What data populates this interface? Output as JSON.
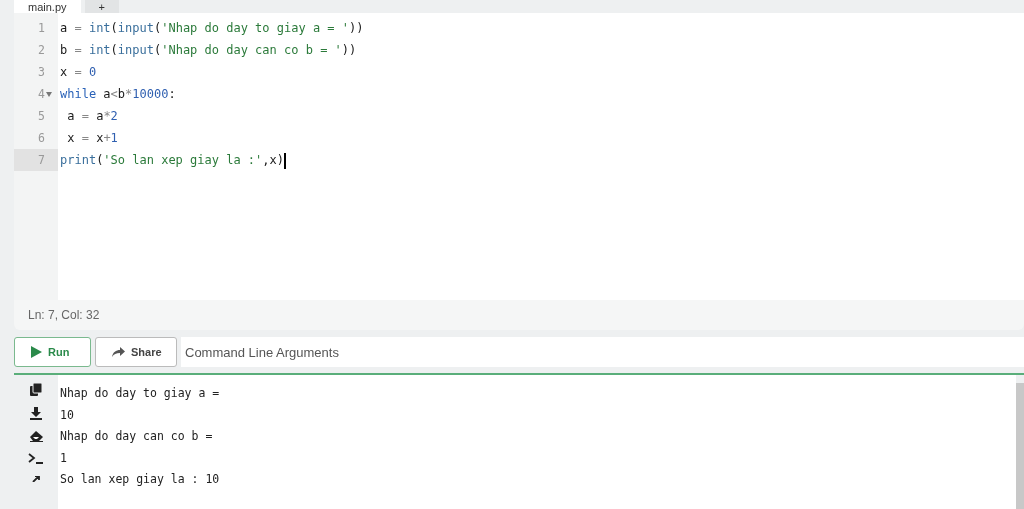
{
  "tabs": [
    {
      "label": "main.py",
      "selected": true
    },
    {
      "label": "+",
      "selected": false
    }
  ],
  "editor": {
    "lines": [
      {
        "number": "1",
        "foldable": false,
        "active": false,
        "tokens": [
          {
            "kind": "plain",
            "text": "a"
          },
          {
            "kind": "op",
            "text": " = "
          },
          {
            "kind": "builtin",
            "text": "int"
          },
          {
            "kind": "plain",
            "text": "("
          },
          {
            "kind": "builtin",
            "text": "input"
          },
          {
            "kind": "plain",
            "text": "("
          },
          {
            "kind": "string",
            "text": "'Nhap do day to giay a = '"
          },
          {
            "kind": "plain",
            "text": "))"
          }
        ]
      },
      {
        "number": "2",
        "foldable": false,
        "active": false,
        "tokens": [
          {
            "kind": "plain",
            "text": "b"
          },
          {
            "kind": "op",
            "text": " = "
          },
          {
            "kind": "builtin",
            "text": "int"
          },
          {
            "kind": "plain",
            "text": "("
          },
          {
            "kind": "builtin",
            "text": "input"
          },
          {
            "kind": "plain",
            "text": "("
          },
          {
            "kind": "string",
            "text": "'Nhap do day can co b = '"
          },
          {
            "kind": "plain",
            "text": "))"
          }
        ]
      },
      {
        "number": "3",
        "foldable": false,
        "active": false,
        "tokens": [
          {
            "kind": "plain",
            "text": "x"
          },
          {
            "kind": "op",
            "text": " = "
          },
          {
            "kind": "number",
            "text": "0"
          }
        ]
      },
      {
        "number": "4",
        "foldable": true,
        "active": false,
        "tokens": [
          {
            "kind": "keyword",
            "text": "while"
          },
          {
            "kind": "plain",
            "text": " a"
          },
          {
            "kind": "op",
            "text": "<"
          },
          {
            "kind": "plain",
            "text": "b"
          },
          {
            "kind": "op",
            "text": "*"
          },
          {
            "kind": "number",
            "text": "10000"
          },
          {
            "kind": "plain",
            "text": ":"
          }
        ]
      },
      {
        "number": "5",
        "foldable": false,
        "active": false,
        "tokens": [
          {
            "kind": "plain",
            "text": " a "
          },
          {
            "kind": "op",
            "text": "="
          },
          {
            "kind": "plain",
            "text": " a"
          },
          {
            "kind": "op",
            "text": "*"
          },
          {
            "kind": "number",
            "text": "2"
          }
        ]
      },
      {
        "number": "6",
        "foldable": false,
        "active": false,
        "tokens": [
          {
            "kind": "plain",
            "text": " x "
          },
          {
            "kind": "op",
            "text": "="
          },
          {
            "kind": "plain",
            "text": " x"
          },
          {
            "kind": "op",
            "text": "+"
          },
          {
            "kind": "number",
            "text": "1"
          }
        ]
      },
      {
        "number": "7",
        "foldable": false,
        "active": true,
        "tokens": [
          {
            "kind": "builtin",
            "text": "print"
          },
          {
            "kind": "plain",
            "text": "("
          },
          {
            "kind": "string",
            "text": "'So lan xep giay la :'"
          },
          {
            "kind": "plain",
            "text": ",x)"
          }
        ]
      }
    ],
    "status": "Ln: 7,  Col: 32"
  },
  "toolbar": {
    "run": "Run",
    "share": "Share",
    "arguments": {
      "placeholder": "Command Line Arguments"
    }
  },
  "output": [
    "Nhap do day to giay a =",
    "10",
    "Nhap do day can co b =",
    "1",
    "So lan xep giay la : 10"
  ]
}
